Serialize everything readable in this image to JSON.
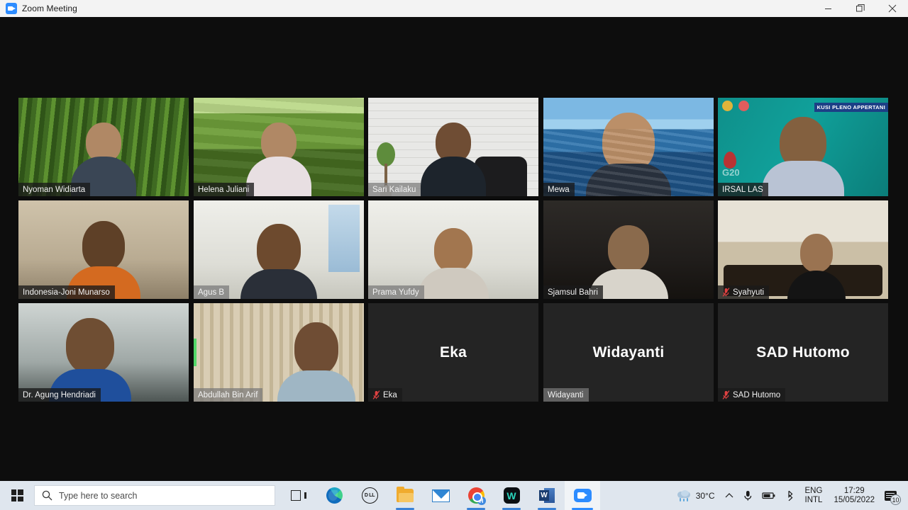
{
  "window": {
    "title": "Zoom Meeting",
    "app_icon": "zoom-video-icon",
    "controls": {
      "minimize": "minimize",
      "restore": "restore",
      "close": "close"
    }
  },
  "meeting": {
    "layout": "gallery-grid",
    "columns": 5,
    "rows": 3,
    "participant_count": 13,
    "active_speaker": "Abdullah Bin Arif",
    "accent_active_border": "#f6e84e",
    "audio_level_color": "#53d769",
    "stage_background": "#0d0d0d",
    "tiles": [
      {
        "name": "Nyoman Widiarta",
        "video": true,
        "muted": false,
        "speaking": false,
        "background": "rice-field",
        "label_style": "dark"
      },
      {
        "name": "Helena Juliani",
        "video": true,
        "muted": false,
        "speaking": false,
        "background": "tea-terrace",
        "label_style": "dark"
      },
      {
        "name": "Sari Kailaku",
        "video": true,
        "muted": false,
        "speaking": false,
        "background": "white-brick-wall",
        "label_style": "light"
      },
      {
        "name": "Mewa",
        "video": true,
        "muted": false,
        "speaking": true,
        "background": "ocean",
        "label_style": "dark"
      },
      {
        "name": "IRSAL LAS",
        "video": true,
        "muted": false,
        "speaking": false,
        "background": "teal-appertani",
        "label_style": "dark",
        "banner_text": "KUSI PLENO APPERTANI",
        "watermark": "G20"
      },
      {
        "name": "Indonesia-Joni Munarso",
        "video": true,
        "muted": false,
        "speaking": false,
        "background": "room-beige",
        "label_style": "dark"
      },
      {
        "name": "Agus B",
        "video": true,
        "muted": false,
        "speaking": false,
        "background": "room-white",
        "label_style": "light"
      },
      {
        "name": "Prama Yufdy",
        "video": true,
        "muted": false,
        "speaking": false,
        "background": "room-white",
        "label_style": "light"
      },
      {
        "name": "Sjamsul Bahri",
        "video": true,
        "muted": false,
        "speaking": false,
        "background": "room-dark",
        "label_style": "dark"
      },
      {
        "name": "Syahyuti",
        "video": true,
        "muted": true,
        "speaking": false,
        "background": "living-room",
        "label_style": "dark"
      },
      {
        "name": "Dr. Agung Hendriadi",
        "video": true,
        "muted": false,
        "speaking": false,
        "background": "office",
        "label_style": "dark"
      },
      {
        "name": "Abdullah Bin Arif",
        "video": true,
        "muted": false,
        "speaking": false,
        "background": "curtain",
        "label_style": "light"
      },
      {
        "name": "Eka",
        "video": false,
        "muted": true,
        "speaking": false,
        "avatar_text": "Eka",
        "label_style": "dark"
      },
      {
        "name": "Widayanti",
        "video": false,
        "muted": false,
        "speaking": false,
        "avatar_text": "Widayanti",
        "label_style": "light"
      },
      {
        "name": "SAD Hutomo",
        "video": false,
        "muted": true,
        "speaking": false,
        "avatar_text": "SAD Hutomo",
        "label_style": "dark"
      }
    ]
  },
  "taskbar": {
    "start": "start-button",
    "search": {
      "placeholder": "Type here to search",
      "icon": "search-icon"
    },
    "task_view": "task-view-button",
    "apps": [
      {
        "name": "Microsoft Edge",
        "icon": "edge-icon",
        "running": false,
        "current": false
      },
      {
        "name": "Dell",
        "icon": "dell-icon",
        "label": "D LL",
        "running": false,
        "current": false
      },
      {
        "name": "File Explorer",
        "icon": "folder-icon",
        "running": true,
        "current": false
      },
      {
        "name": "Mail",
        "icon": "mail-icon",
        "running": false,
        "current": false
      },
      {
        "name": "Google Chrome",
        "icon": "chrome-icon",
        "badge": "H",
        "running": true,
        "current": false
      },
      {
        "name": "Wondershare",
        "icon": "w-app-icon",
        "label": "W",
        "running": true,
        "current": false
      },
      {
        "name": "Microsoft Word",
        "icon": "word-icon",
        "label": "W",
        "running": true,
        "current": false
      },
      {
        "name": "Zoom",
        "icon": "zoom-icon",
        "running": true,
        "current": true
      }
    ],
    "tray": {
      "weather": {
        "icon": "rain-cloud-icon",
        "temperature": "30°C"
      },
      "overflow": "show-hidden-icons-chevron",
      "microphone": "microphone-icon",
      "battery": "battery-icon",
      "bluetooth": "bluetooth-icon",
      "language": {
        "line1": "ENG",
        "line2": "INTL"
      },
      "clock": {
        "time": "17:29",
        "date": "15/05/2022"
      },
      "notifications": {
        "icon": "action-center-icon",
        "count": "10"
      }
    }
  }
}
